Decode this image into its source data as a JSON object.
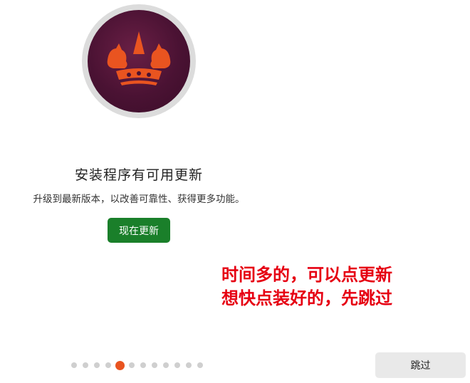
{
  "logo": {
    "name": "crown-logo-icon"
  },
  "content": {
    "title": "安装程序有可用更新",
    "subtitle": "升级到最新版本，以改善可靠性、获得更多功能。",
    "update_button": "现在更新"
  },
  "annotation": {
    "line1": "时间多的，可以点更新",
    "line2": "想快点装好的，先跳过"
  },
  "pager": {
    "total": 12,
    "current": 5
  },
  "footer": {
    "skip_button": "跳过"
  },
  "colors": {
    "primary_button": "#1a7f2a",
    "active_dot": "#e95420",
    "annotation": "#e60012",
    "logo_accent": "#e95420"
  }
}
